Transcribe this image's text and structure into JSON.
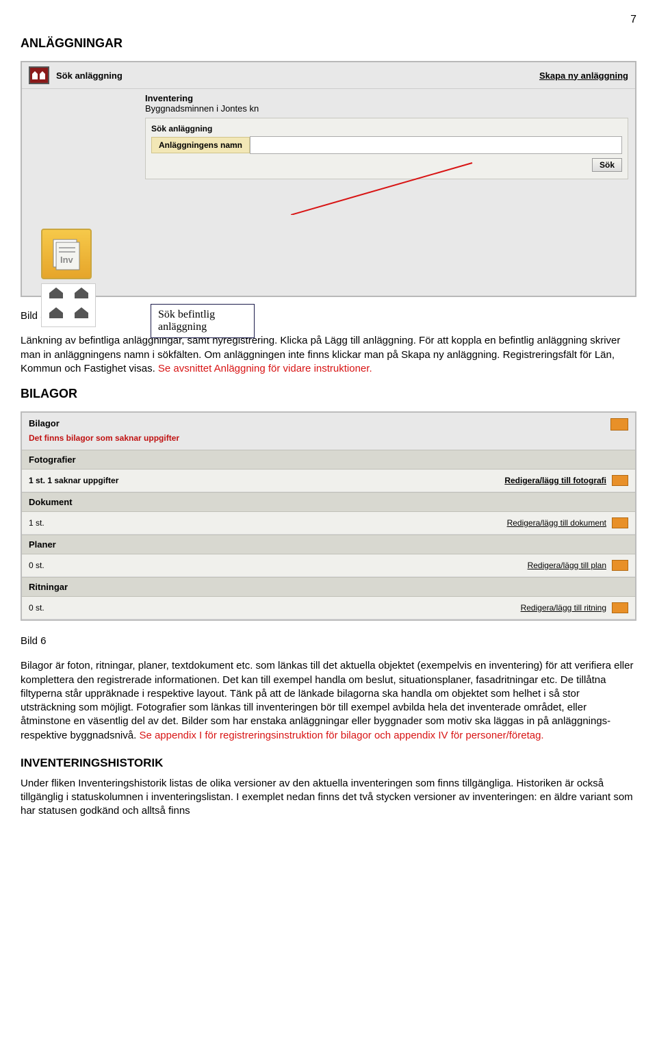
{
  "page_number": "7",
  "h_anlaggningar": "ANLÄGGNINGAR",
  "topbar": {
    "title": "Sök anläggning",
    "create_link": "Skapa ny anläggning"
  },
  "inventering": {
    "label": "Inventering",
    "sub": "Byggnadsminnen i Jontes kn"
  },
  "search_panel": {
    "title": "Sök anläggning",
    "field_label": "Anläggningens namn",
    "button": "Sök"
  },
  "callout_text": "Sök befintlig anläggning",
  "bild5_label": "Bild 5",
  "para_anlaggningar": {
    "t1": "Länkning av befintliga anläggningar, samt nyregistrering. Klicka på Lägg till anläggning. För att koppla en befintlig anläggning skriver man in anläggningens namn i sökfälten. Om anläggningen inte finns klickar man på Skapa ny anläggning. Registreringsfält för Län, Kommun och Fastighet visas. ",
    "red": "Se avsnittet Anläggning för vidare instruktioner."
  },
  "h_bilagor": "BILAGOR",
  "bilagor_panel": {
    "title": "Bilagor",
    "warn": "Det finns bilagor som saknar uppgifter",
    "sections": {
      "fotografier": {
        "head": "Fotografier",
        "count": "1 st. 1 saknar uppgifter",
        "link": "Redigera/lägg till fotografi"
      },
      "dokument": {
        "head": "Dokument",
        "count": "1 st.",
        "link": "Redigera/lägg till dokument"
      },
      "planer": {
        "head": "Planer",
        "count": "0 st.",
        "link": "Redigera/lägg till plan"
      },
      "ritningar": {
        "head": "Ritningar",
        "count": "0 st.",
        "link": "Redigera/lägg till ritning"
      }
    }
  },
  "bild6_label": "Bild 6",
  "para_bilagor": {
    "t1": "Bilagor är foton, ritningar, planer, textdokument etc. som länkas till det aktuella objektet (exempelvis en inventering) för att verifiera eller komplettera den registrerade informationen. Det kan till exempel handla om beslut, situationsplaner, fasadritningar etc. De tillåtna filtyperna står uppräknade i respektive layout. Tänk på att de länkade bilagorna ska handla om objektet som helhet i så stor utsträckning som möjligt. Fotografier som länkas till inventeringen bör till exempel avbilda hela det inventerade området, eller åtminstone en väsentlig del av det. Bilder som har enstaka anläggningar eller byggnader som motiv ska läggas in på anläggnings- respektive byggnadsnivå. ",
    "red": "Se appendix I för registreringsinstruktion för bilagor och appendix IV för personer/företag."
  },
  "h_historik": "INVENTERINGSHISTORIK",
  "para_historik": "Under fliken Inventeringshistorik listas de olika versioner av den aktuella inventeringen som finns tillgängliga. Historiken är också tillgänglig i statuskolumnen i inventeringslistan. I exemplet nedan finns det två stycken versioner av inventeringen: en äldre variant som har statusen godkänd och alltså finns"
}
